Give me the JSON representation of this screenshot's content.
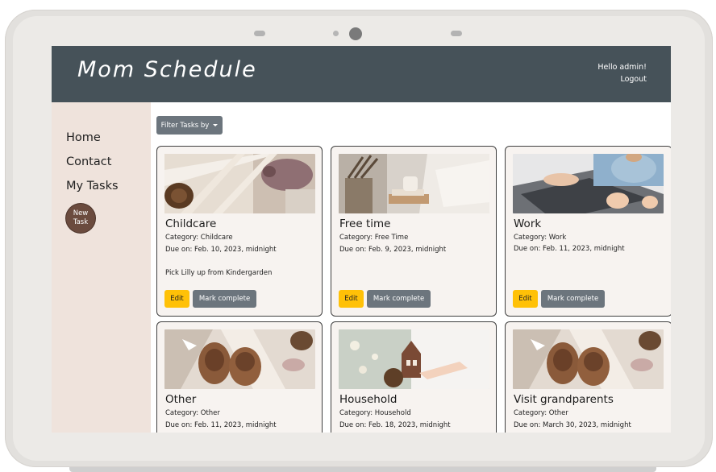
{
  "app": {
    "brand": "Mom Schedule"
  },
  "user": {
    "greeting": "Hello admin!",
    "logout_label": "Logout"
  },
  "sidebar": {
    "items": [
      {
        "label": "Home"
      },
      {
        "label": "Contact"
      },
      {
        "label": "My Tasks"
      }
    ],
    "new_task_line1": "New",
    "new_task_line2": "Task"
  },
  "toolbar": {
    "filter_label": "Filter Tasks by"
  },
  "cards": [
    {
      "title": "Childcare",
      "category": "Category: Childcare",
      "due": "Due on: Feb. 10, 2023, midnight",
      "description": "Pick Lilly up from Kindergarden",
      "edit_label": "Edit",
      "complete_label": "Mark complete"
    },
    {
      "title": "Free time",
      "category": "Category: Free Time",
      "due": "Due on: Feb. 9, 2023, midnight",
      "description": "",
      "edit_label": "Edit",
      "complete_label": "Mark complete"
    },
    {
      "title": "Work",
      "category": "Category: Work",
      "due": "Due on: Feb. 11, 2023, midnight",
      "description": "",
      "edit_label": "Edit",
      "complete_label": "Mark complete"
    },
    {
      "title": "Other",
      "category": "Category: Other",
      "due": "Due on: Feb. 11, 2023, midnight"
    },
    {
      "title": "Household",
      "category": "Category: Household",
      "due": "Due on: Feb. 18, 2023, midnight"
    },
    {
      "title": "Visit grandparents",
      "category": "Category: Other",
      "due": "Due on: March 30, 2023, midnight"
    }
  ],
  "colors": {
    "header": "#465259",
    "sidebar": "#efe3dc",
    "card": "#f7f3f0",
    "edit": "#ffc107",
    "secondary": "#6c757d"
  }
}
